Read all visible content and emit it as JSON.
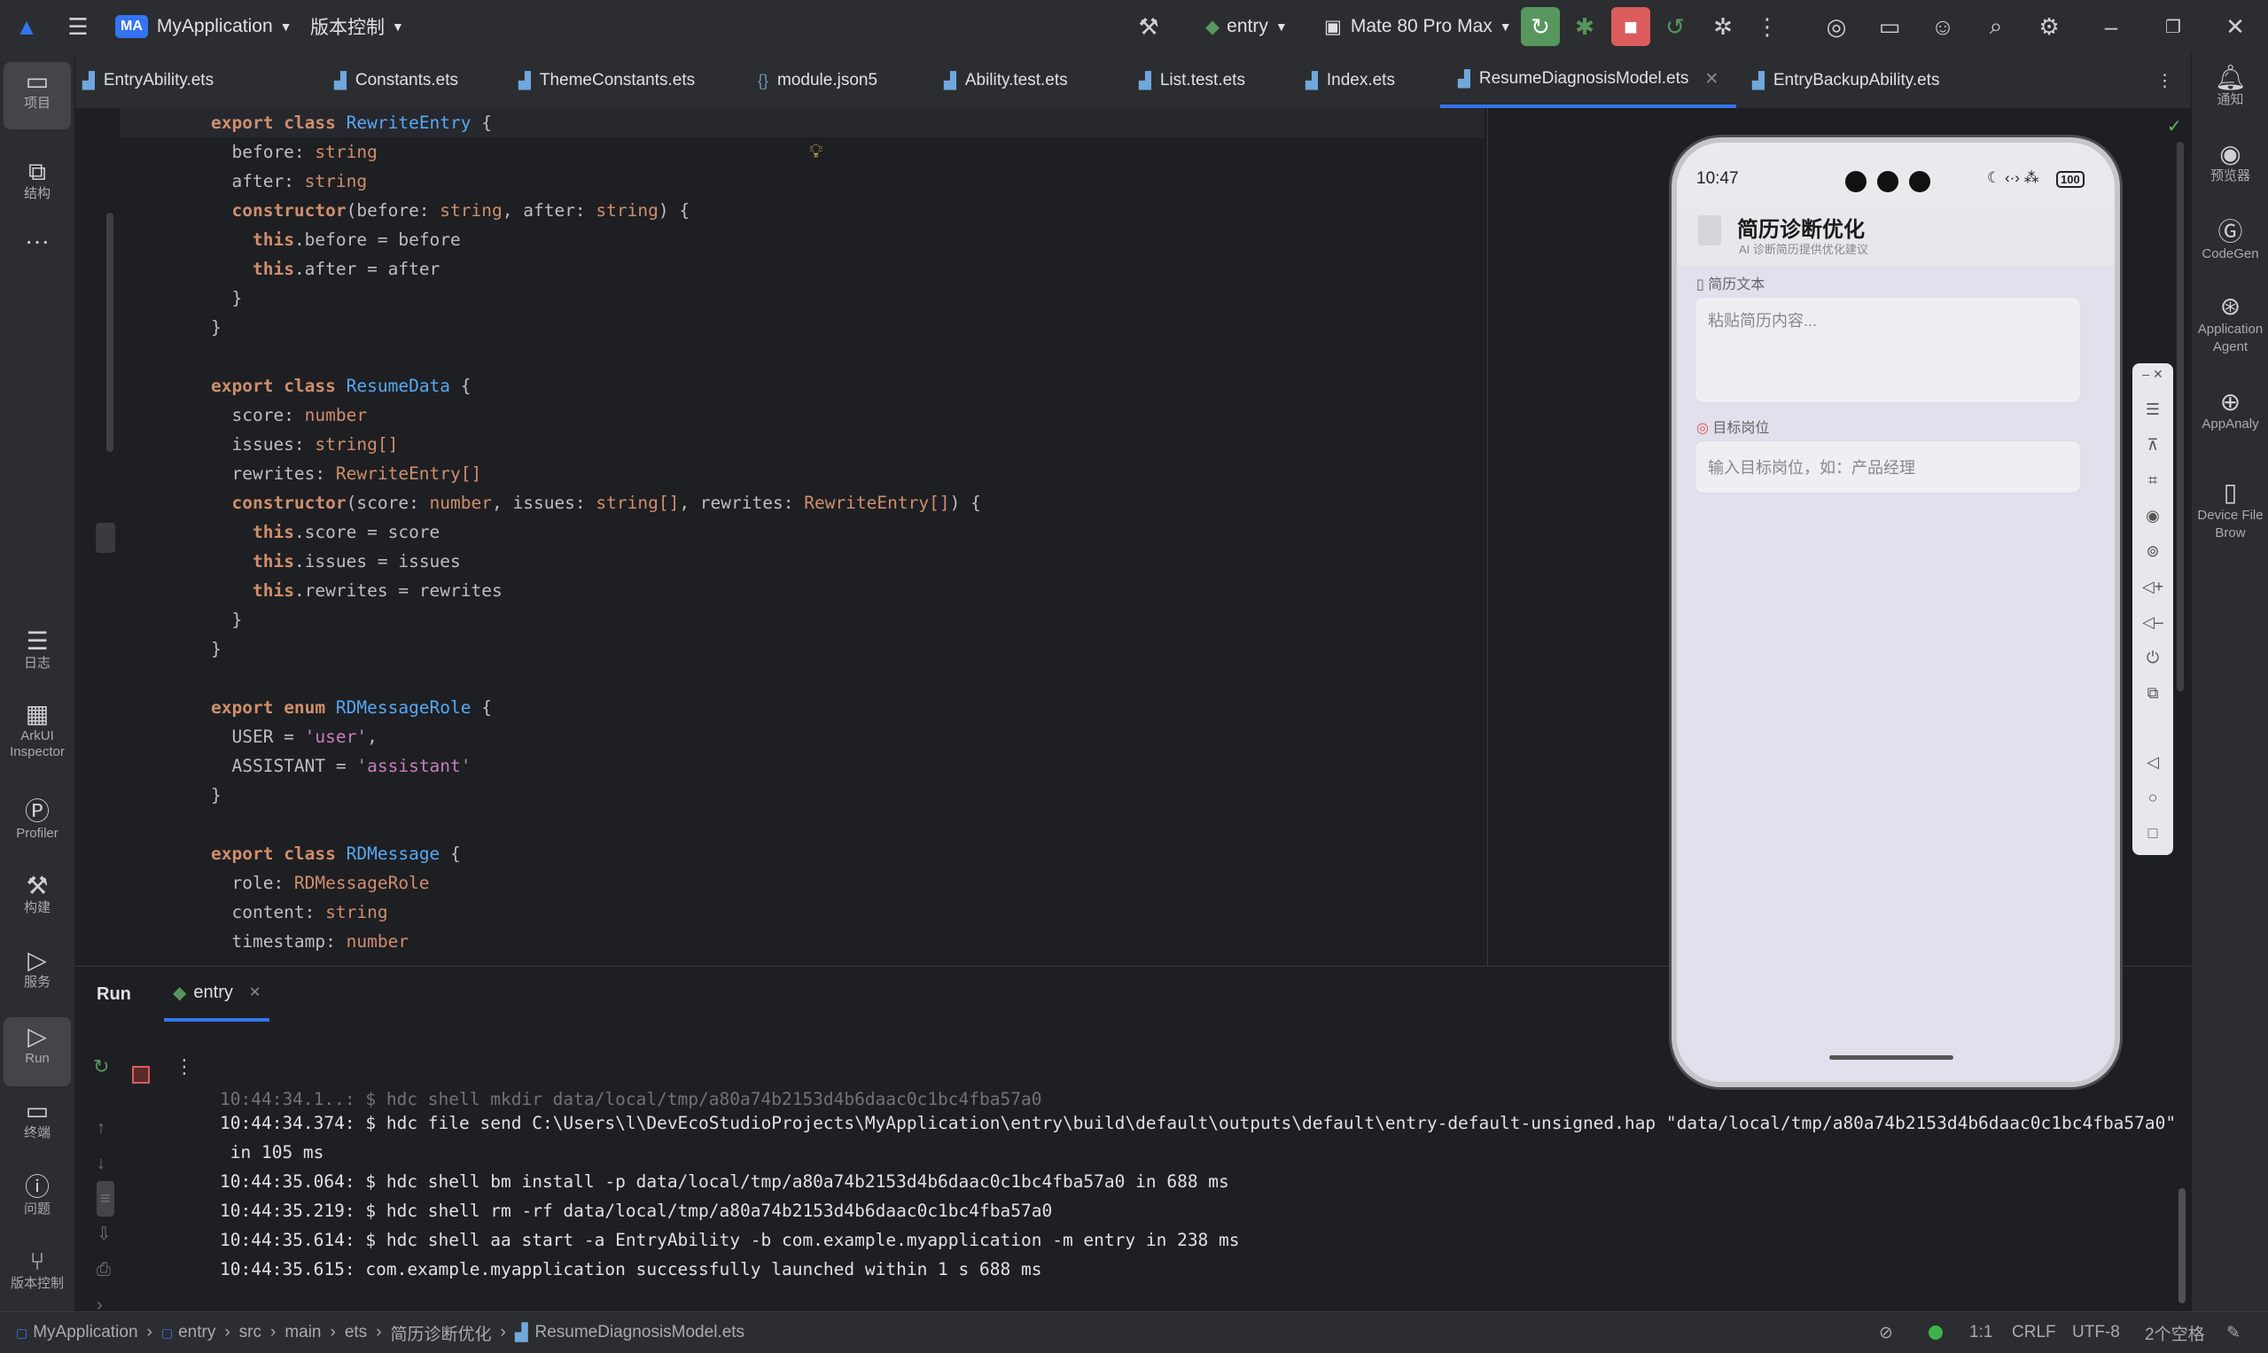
{
  "titlebar": {
    "project_badge": "MA",
    "project_name": "MyApplication",
    "vcs_menu": "版本控制",
    "run_config": "entry",
    "device": "Mate 80 Pro Max"
  },
  "left_tools": [
    {
      "label": "项目"
    },
    {
      "label": "结构"
    },
    {
      "label": "···"
    },
    {
      "label": "日志"
    },
    {
      "label": "ArkUI\nInspector"
    },
    {
      "label": "Profiler"
    },
    {
      "label": "构建"
    },
    {
      "label": "服务"
    },
    {
      "label": "Run"
    },
    {
      "label": "终端"
    },
    {
      "label": "问题"
    },
    {
      "label": "版本控制"
    }
  ],
  "right_tools": [
    {
      "label": "通知"
    },
    {
      "label": "预览器"
    },
    {
      "label": "CodeGen"
    },
    {
      "label": "Application Agent"
    },
    {
      "label": "AppAnaly"
    },
    {
      "label": "Device File Brow"
    }
  ],
  "tabs": [
    {
      "label": "EntryAbility.ets",
      "icon": "ets-file-icon"
    },
    {
      "label": "Constants.ets",
      "icon": "ets-file-icon"
    },
    {
      "label": "ThemeConstants.ets",
      "icon": "ets-file-icon"
    },
    {
      "label": "module.json5",
      "icon": "json-file-icon"
    },
    {
      "label": "Ability.test.ets",
      "icon": "ets-file-icon"
    },
    {
      "label": "List.test.ets",
      "icon": "ets-file-icon"
    },
    {
      "label": "Index.ets",
      "icon": "ets-file-icon"
    },
    {
      "label": "ResumeDiagnosisModel.ets",
      "icon": "ets-file-icon",
      "active": true
    },
    {
      "label": "EntryBackupAbility.ets",
      "icon": "ets-file-icon"
    }
  ],
  "code_lines": [
    [
      [
        "kw",
        "export "
      ],
      [
        "kw",
        "class "
      ],
      [
        "cls",
        "RewriteEntry "
      ],
      [
        "",
        "{"
      ]
    ],
    [
      [
        "",
        "  before: "
      ],
      [
        "ty",
        "string"
      ]
    ],
    [
      [
        "",
        "  after: "
      ],
      [
        "ty",
        "string"
      ]
    ],
    [
      [
        "",
        "  "
      ],
      [
        "kw",
        "constructor"
      ],
      [
        "",
        "(before: "
      ],
      [
        "ty",
        "string"
      ],
      [
        "",
        ", after: "
      ],
      [
        "ty",
        "string"
      ],
      [
        "",
        ") {"
      ]
    ],
    [
      [
        "",
        "    "
      ],
      [
        "kw",
        "this"
      ],
      [
        "",
        ".before = before"
      ]
    ],
    [
      [
        "",
        "    "
      ],
      [
        "kw",
        "this"
      ],
      [
        "",
        ".after = after"
      ]
    ],
    [
      [
        "",
        "  }"
      ]
    ],
    [
      [
        "",
        "}"
      ]
    ],
    [
      [
        "",
        ""
      ]
    ],
    [
      [
        "kw",
        "export "
      ],
      [
        "kw",
        "class "
      ],
      [
        "cls",
        "ResumeData "
      ],
      [
        "",
        "{"
      ]
    ],
    [
      [
        "",
        "  score: "
      ],
      [
        "ty",
        "number"
      ]
    ],
    [
      [
        "",
        "  issues: "
      ],
      [
        "ty",
        "string[]"
      ]
    ],
    [
      [
        "",
        "  rewrites: "
      ],
      [
        "ty",
        "RewriteEntry[]"
      ]
    ],
    [
      [
        "",
        "  "
      ],
      [
        "kw",
        "constructor"
      ],
      [
        "",
        "(score: "
      ],
      [
        "ty",
        "number"
      ],
      [
        "",
        ", issues: "
      ],
      [
        "ty",
        "string[]"
      ],
      [
        "",
        ", rewrites: "
      ],
      [
        "ty",
        "RewriteEntry[]"
      ],
      [
        "",
        ") {"
      ]
    ],
    [
      [
        "",
        "    "
      ],
      [
        "kw",
        "this"
      ],
      [
        "",
        ".score = score"
      ]
    ],
    [
      [
        "",
        "    "
      ],
      [
        "kw",
        "this"
      ],
      [
        "",
        ".issues = issues"
      ]
    ],
    [
      [
        "",
        "    "
      ],
      [
        "kw",
        "this"
      ],
      [
        "",
        ".rewrites = rewrites"
      ]
    ],
    [
      [
        "",
        "  }"
      ]
    ],
    [
      [
        "",
        "}"
      ]
    ],
    [
      [
        "",
        ""
      ]
    ],
    [
      [
        "kw",
        "export "
      ],
      [
        "kw",
        "enum "
      ],
      [
        "cls",
        "RDMessageRole "
      ],
      [
        "",
        "{"
      ]
    ],
    [
      [
        "",
        "  USER = "
      ],
      [
        "str",
        "'user'"
      ],
      [
        "",
        ","
      ]
    ],
    [
      [
        "",
        "  ASSISTANT = "
      ],
      [
        "str",
        "'assistant'"
      ]
    ],
    [
      [
        "",
        "}"
      ]
    ],
    [
      [
        "",
        ""
      ]
    ],
    [
      [
        "kw",
        "export "
      ],
      [
        "kw",
        "class "
      ],
      [
        "cls",
        "RDMessage "
      ],
      [
        "",
        "{"
      ]
    ],
    [
      [
        "",
        "  role: "
      ],
      [
        "ty",
        "RDMessageRole"
      ]
    ],
    [
      [
        "",
        "  content: "
      ],
      [
        "ty",
        "string"
      ]
    ],
    [
      [
        "",
        "  timestamp: "
      ],
      [
        "ty",
        "number"
      ]
    ]
  ],
  "run_panel": {
    "title": "Run",
    "tab_label": "entry",
    "console": [
      "10:44:34.374: $ hdc file send C:\\Users\\l\\DevEcoStudioProjects\\MyApplication\\entry\\build\\default\\outputs\\default\\entry-default-unsigned.hap \"data/local/tmp/a80a74b2153d4b6daac0c1bc4fba57a0\"",
      " in 105 ms",
      "10:44:35.064: $ hdc shell bm install -p data/local/tmp/a80a74b2153d4b6daac0c1bc4fba57a0 in 688 ms",
      "10:44:35.219: $ hdc shell rm -rf data/local/tmp/a80a74b2153d4b6daac0c1bc4fba57a0",
      "10:44:35.614: $ hdc shell aa start -a EntryAbility -b com.example.myapplication -m entry in 238 ms",
      "10:44:35.615: com.example.myapplication successfully launched within 1 s 688 ms"
    ]
  },
  "phone": {
    "time": "10:47",
    "battery": "100",
    "app_title": "简历诊断优化",
    "app_subtitle": "AI 诊断简历提供优化建议",
    "resume_label": "简历文本",
    "resume_placeholder": "粘贴简历内容...",
    "target_label": "目标岗位",
    "target_placeholder": "输入目标岗位，如：产品经理"
  },
  "statusbar": {
    "breadcrumb": [
      "MyApplication",
      "entry",
      "src",
      "main",
      "ets",
      "简历诊断优化",
      "ResumeDiagnosisModel.ets"
    ],
    "position": "1:1",
    "line_sep": "CRLF",
    "encoding": "UTF-8",
    "indent": "2个空格"
  },
  "colors": {
    "accent": "#3574f0",
    "run_green": "#57965c",
    "stop_red": "#db5c5c"
  }
}
